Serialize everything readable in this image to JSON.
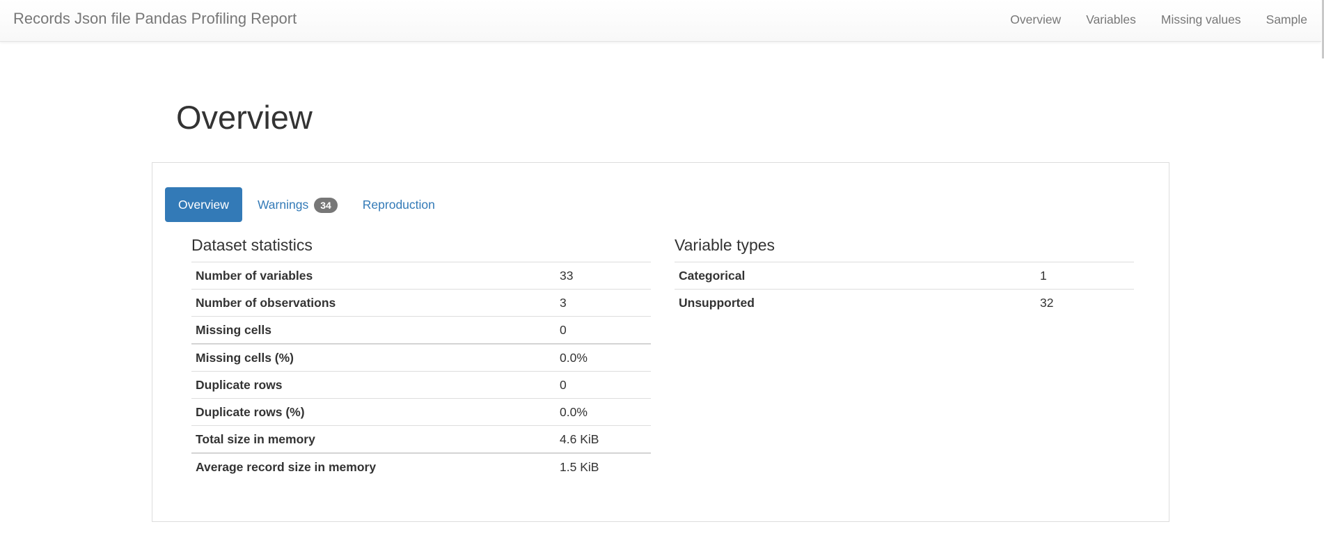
{
  "navbar": {
    "brand": "Records Json file Pandas Profiling Report",
    "links": [
      "Overview",
      "Variables",
      "Missing values",
      "Sample"
    ]
  },
  "page": {
    "title": "Overview"
  },
  "tabs": {
    "overview": "Overview",
    "warnings": "Warnings",
    "warnings_count": "34",
    "reproduction": "Reproduction"
  },
  "dataset_statistics": {
    "title": "Dataset statistics",
    "rows": [
      {
        "label": "Number of variables",
        "value": "33"
      },
      {
        "label": "Number of observations",
        "value": "3"
      },
      {
        "label": "Missing cells",
        "value": "0"
      },
      {
        "label": "Missing cells (%)",
        "value": "0.0%"
      },
      {
        "label": "Duplicate rows",
        "value": "0"
      },
      {
        "label": "Duplicate rows (%)",
        "value": "0.0%"
      },
      {
        "label": "Total size in memory",
        "value": "4.6 KiB"
      },
      {
        "label": "Average record size in memory",
        "value": "1.5 KiB"
      }
    ]
  },
  "variable_types": {
    "title": "Variable types",
    "rows": [
      {
        "label": "Categorical",
        "value": "1"
      },
      {
        "label": "Unsupported",
        "value": "32"
      }
    ]
  },
  "colors": {
    "accent": "#337ab7",
    "badge": "#777777",
    "nav_text": "#777777"
  }
}
